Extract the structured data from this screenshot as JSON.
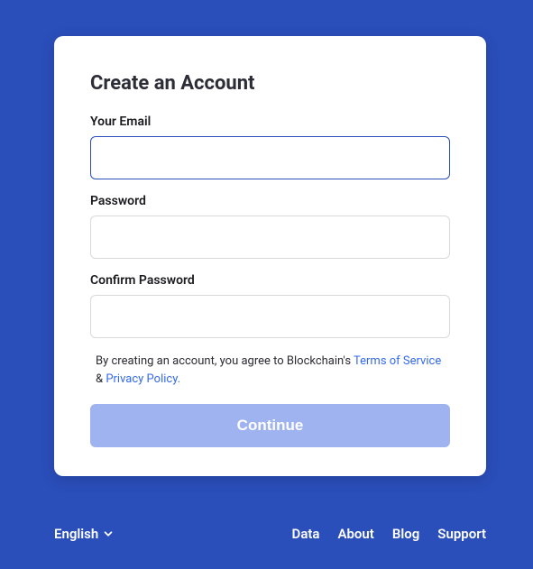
{
  "card": {
    "title": "Create an Account",
    "email": {
      "label": "Your Email",
      "value": ""
    },
    "password": {
      "label": "Password",
      "value": ""
    },
    "confirm_password": {
      "label": "Confirm Password",
      "value": ""
    },
    "agreement": {
      "prefix": "By creating an account, you agree to Blockchain's ",
      "terms_label": "Terms of Service",
      "separator": " & ",
      "privacy_label": "Privacy Policy."
    },
    "continue_label": "Continue"
  },
  "footer": {
    "language": "English",
    "links": {
      "data": "Data",
      "about": "About",
      "blog": "Blog",
      "support": "Support"
    }
  }
}
